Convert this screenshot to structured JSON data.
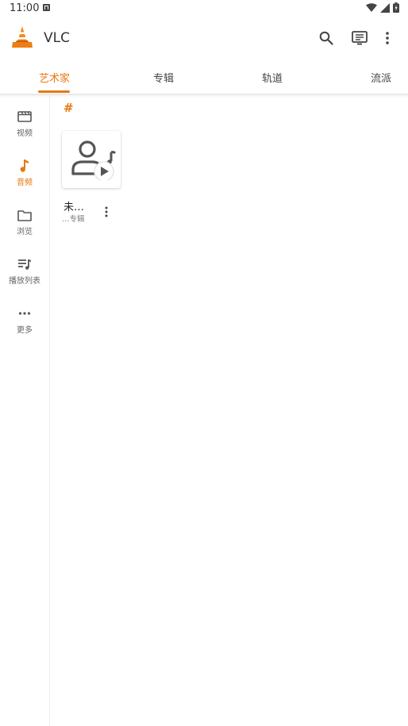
{
  "status": {
    "time": "11:00"
  },
  "app": {
    "title": "VLC"
  },
  "tabs": [
    {
      "label": "艺术家"
    },
    {
      "label": "专辑"
    },
    {
      "label": "轨道"
    },
    {
      "label": "流派"
    }
  ],
  "sidebar": {
    "items": [
      {
        "label": "视频"
      },
      {
        "label": "音频"
      },
      {
        "label": "浏览"
      },
      {
        "label": "播放列表"
      },
      {
        "label": "更多"
      }
    ]
  },
  "section": {
    "header": "#"
  },
  "artists": [
    {
      "name": "未…",
      "subtitle": "…专辑"
    }
  ],
  "colors": {
    "accent": "#e8770e"
  }
}
